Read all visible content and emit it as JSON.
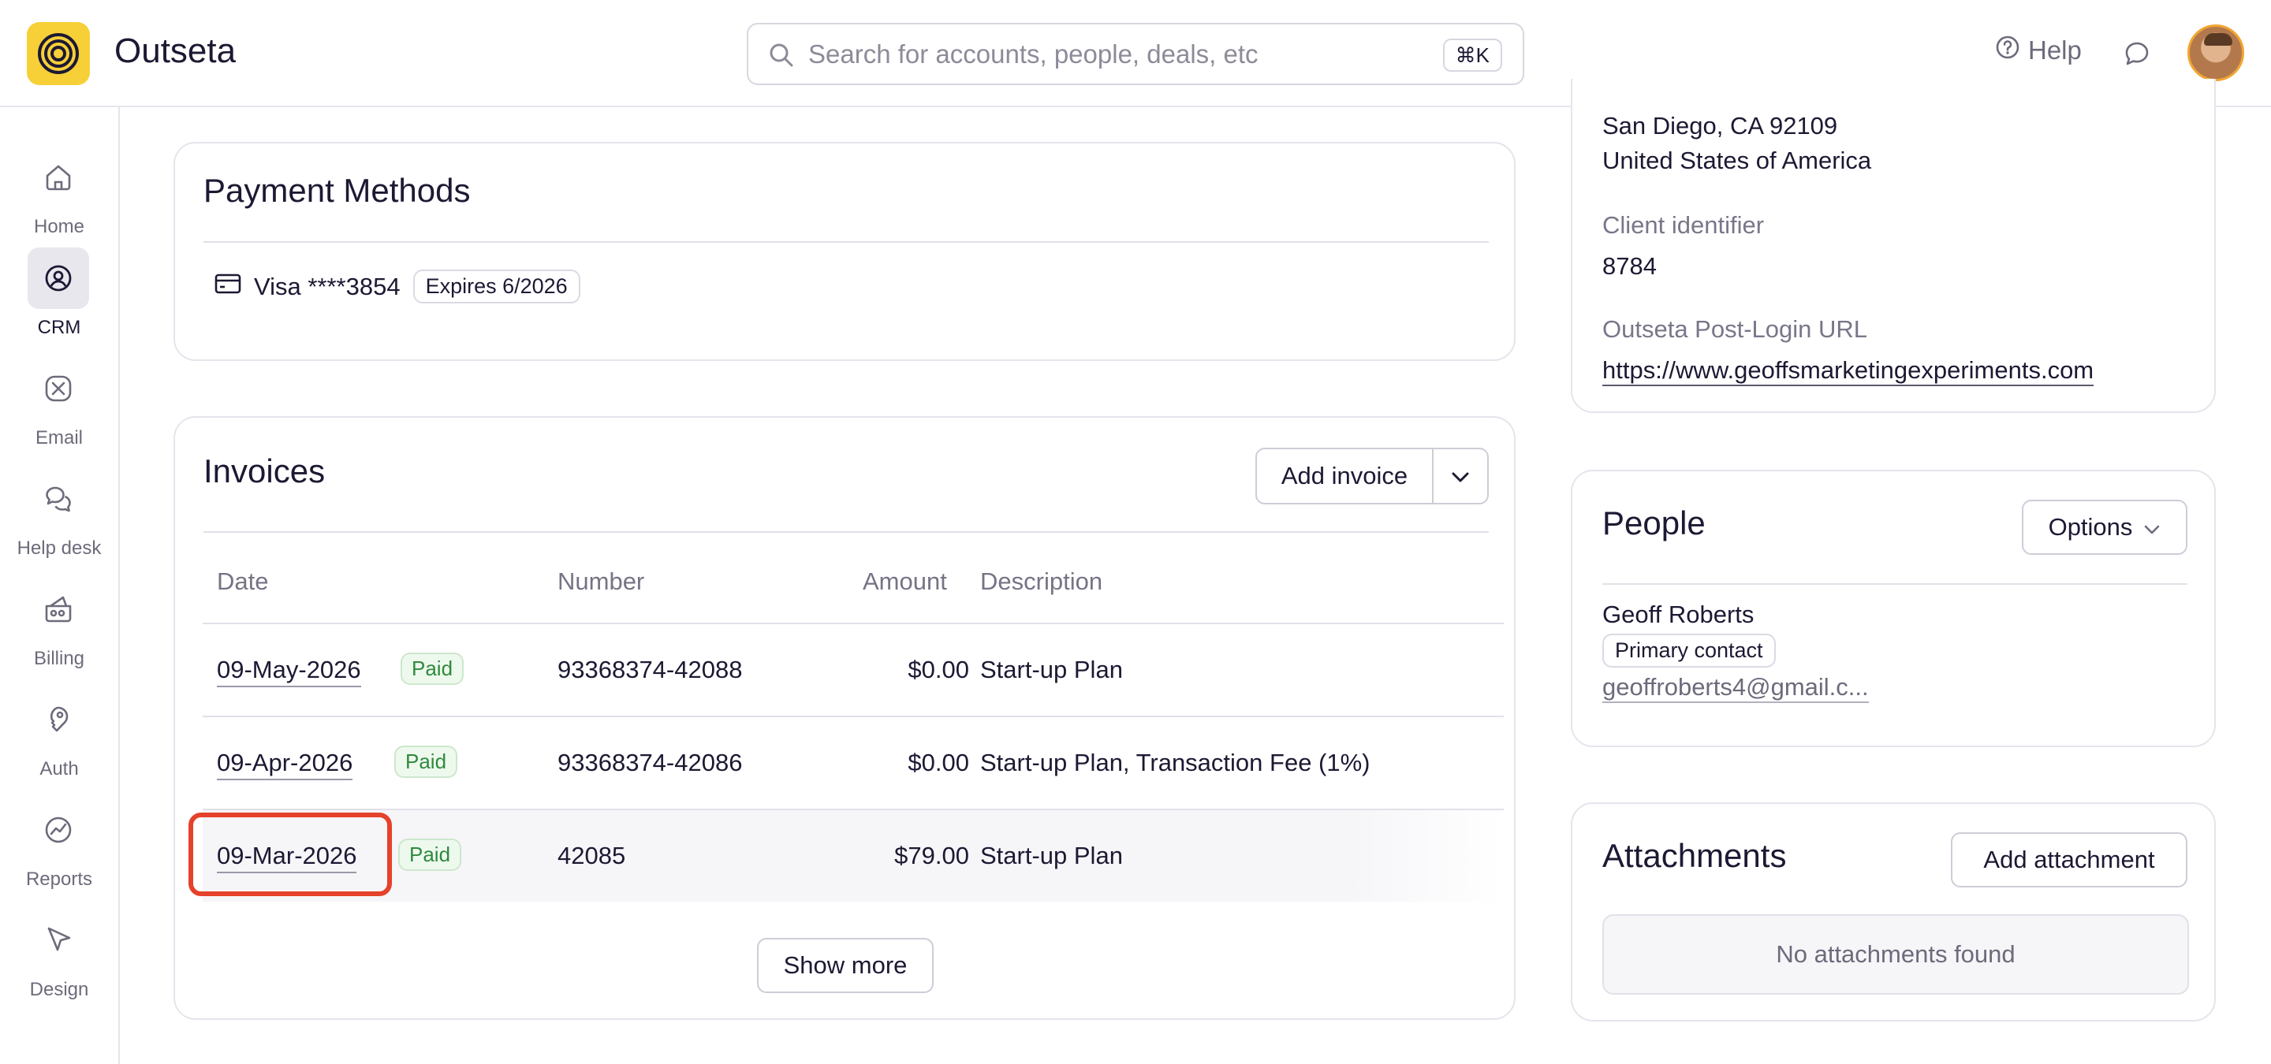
{
  "app": {
    "name": "Outseta"
  },
  "search": {
    "placeholder": "Search for accounts, people, deals, etc",
    "shortcut": "⌘K"
  },
  "header": {
    "help_label": "Help"
  },
  "sidebar": {
    "items": [
      {
        "label": "Home",
        "icon": "home-icon",
        "active": false
      },
      {
        "label": "CRM",
        "icon": "crm-icon",
        "active": true
      },
      {
        "label": "Email",
        "icon": "email-icon",
        "active": false
      },
      {
        "label": "Help desk",
        "icon": "help-desk-icon",
        "active": false
      },
      {
        "label": "Billing",
        "icon": "billing-icon",
        "active": false
      },
      {
        "label": "Auth",
        "icon": "auth-icon",
        "active": false
      },
      {
        "label": "Reports",
        "icon": "reports-icon",
        "active": false
      },
      {
        "label": "Design",
        "icon": "design-icon",
        "active": false
      }
    ]
  },
  "payment_methods": {
    "title": "Payment Methods",
    "card_label": "Visa ****3854",
    "expires": "Expires 6/2026"
  },
  "invoices": {
    "title": "Invoices",
    "add_label": "Add invoice",
    "columns": {
      "date": "Date",
      "number": "Number",
      "amount": "Amount",
      "description": "Description"
    },
    "rows": [
      {
        "date": "09-May-2026",
        "status": "Paid",
        "number": "93368374-42088",
        "amount": "$0.00",
        "description": "Start-up Plan"
      },
      {
        "date": "09-Apr-2026",
        "status": "Paid",
        "number": "93368374-42086",
        "amount": "$0.00",
        "description": "Start-up Plan, Transaction Fee (1%)"
      },
      {
        "date": "09-Mar-2026",
        "status": "Paid",
        "number": "42085",
        "amount": "$79.00",
        "description": "Start-up Plan"
      }
    ],
    "show_more_label": "Show more"
  },
  "account_info": {
    "address_line1": "San Diego, CA  92109",
    "address_line2": "United States of America",
    "client_identifier_label": "Client identifier",
    "client_identifier_value": "8784",
    "post_login_label": "Outseta Post-Login URL",
    "post_login_value": "https://www.geoffsmarketingexperiments.com"
  },
  "people": {
    "title": "People",
    "options_label": "Options",
    "person_name": "Geoff Roberts",
    "person_badge": "Primary contact",
    "person_email": "geoffroberts4@gmail.c..."
  },
  "attachments": {
    "title": "Attachments",
    "add_label": "Add attachment",
    "empty_text": "No attachments found"
  },
  "colors": {
    "brand": "#f7cf37",
    "highlight": "#e5412b",
    "paid_green": "#2f8a3c"
  }
}
